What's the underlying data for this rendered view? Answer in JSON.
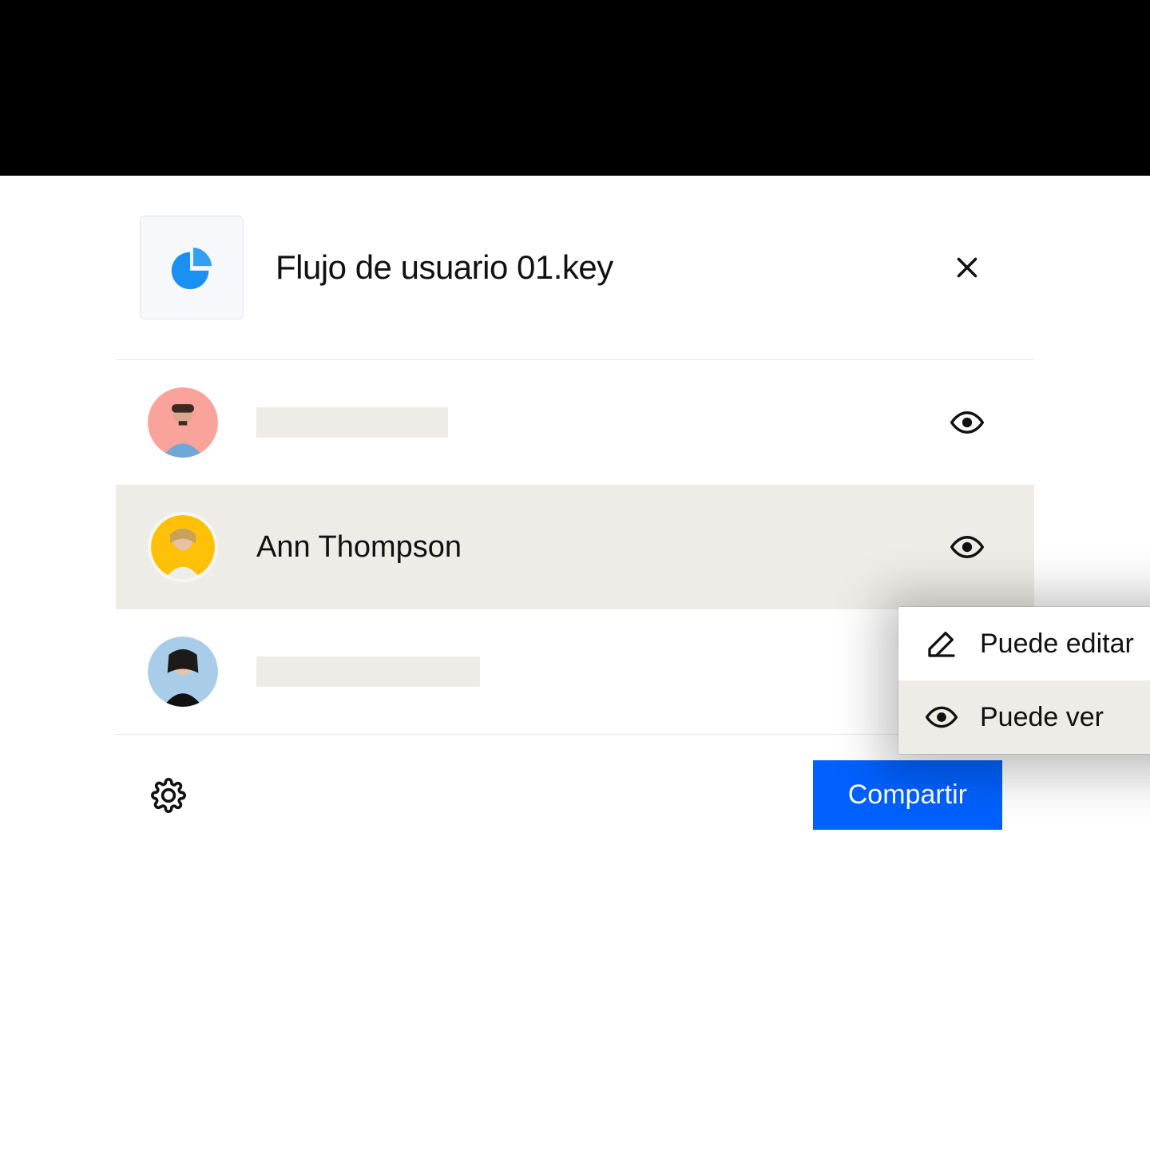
{
  "header": {
    "file_name": "Flujo de usuario 01.key"
  },
  "users": [
    {
      "name": "",
      "avatar_bg": "#f9a39a",
      "permission_icon": "eye"
    },
    {
      "name": "Ann Thompson",
      "avatar_bg": "#ffc107",
      "permission_icon": "eye",
      "selected": true
    },
    {
      "name": "",
      "avatar_bg": "#a9cde8",
      "permission_icon": ""
    }
  ],
  "footer": {
    "share_label": "Compartir"
  },
  "popover": {
    "items": [
      {
        "icon": "pencil",
        "label": "Puede editar",
        "active": false
      },
      {
        "icon": "eye",
        "label": "Puede ver",
        "active": true
      }
    ]
  },
  "colors": {
    "primary": "#0061fe"
  }
}
